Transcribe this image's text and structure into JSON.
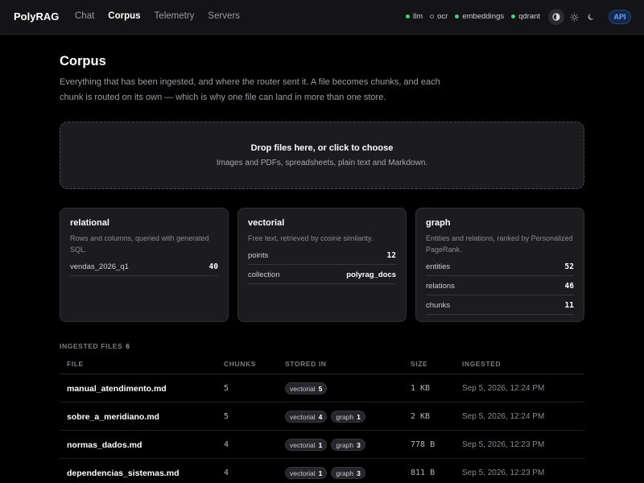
{
  "app": {
    "brand": "PolyRAG",
    "nav": [
      {
        "label": "Chat",
        "active": false
      },
      {
        "label": "Corpus",
        "active": true
      },
      {
        "label": "Telemetry",
        "active": false
      },
      {
        "label": "Servers",
        "active": false
      }
    ],
    "status": [
      {
        "label": "llm",
        "state": "up"
      },
      {
        "label": "ocr",
        "state": "down"
      },
      {
        "label": "embeddings",
        "state": "up"
      },
      {
        "label": "qdrant",
        "state": "up"
      }
    ],
    "theme_icons": [
      "contrast-icon",
      "sun-icon",
      "moon-icon"
    ],
    "api_label": "API"
  },
  "page": {
    "title": "Corpus",
    "description": "Everything that has been ingested, and where the router sent it. A file becomes chunks, and each chunk is routed on its own — which is why one file can land in more than one store."
  },
  "dropzone": {
    "title": "Drop files here, or click to choose",
    "subtitle": "Images and PDFs, spreadsheets, plain text and Markdown."
  },
  "stores": {
    "relational": {
      "title": "relational",
      "desc": "Rows and columns, queried with generated SQL.",
      "rows": [
        {
          "key": "vendas_2026_q1",
          "value": "40"
        }
      ]
    },
    "vectorial": {
      "title": "vectorial",
      "desc": "Free text, retrieved by cosine similarity.",
      "rows": [
        {
          "key": "points",
          "value": "12"
        },
        {
          "key": "collection",
          "value": "polyrag_docs"
        }
      ]
    },
    "graph": {
      "title": "graph",
      "desc": "Entities and relations, ranked by Personalized PageRank.",
      "rows": [
        {
          "key": "entities",
          "value": "52"
        },
        {
          "key": "relations",
          "value": "46"
        },
        {
          "key": "chunks",
          "value": "11"
        }
      ]
    }
  },
  "files": {
    "label": "INGESTED FILES",
    "count": "6",
    "columns": {
      "file": "FILE",
      "chunks": "CHUNKS",
      "stored_in": "STORED IN",
      "size": "SIZE",
      "ingested": "INGESTED"
    },
    "rows": [
      {
        "name": "manual_atendimento.md",
        "chunks": "5",
        "stores": [
          {
            "name": "vectorial",
            "n": "5"
          }
        ],
        "size": "1 KB",
        "ingested": "Sep 5, 2026, 12:24 PM"
      },
      {
        "name": "sobre_a_meridiano.md",
        "chunks": "5",
        "stores": [
          {
            "name": "vectorial",
            "n": "4"
          },
          {
            "name": "graph",
            "n": "1"
          }
        ],
        "size": "2 KB",
        "ingested": "Sep 5, 2026, 12:24 PM"
      },
      {
        "name": "normas_dados.md",
        "chunks": "4",
        "stores": [
          {
            "name": "vectorial",
            "n": "1"
          },
          {
            "name": "graph",
            "n": "3"
          }
        ],
        "size": "778 B",
        "ingested": "Sep 5, 2026, 12:23 PM"
      },
      {
        "name": "dependencias_sistemas.md",
        "chunks": "4",
        "stores": [
          {
            "name": "vectorial",
            "n": "1"
          },
          {
            "name": "graph",
            "n": "3"
          }
        ],
        "size": "811 B",
        "ingested": "Sep 5, 2026, 12:23 PM"
      }
    ]
  }
}
